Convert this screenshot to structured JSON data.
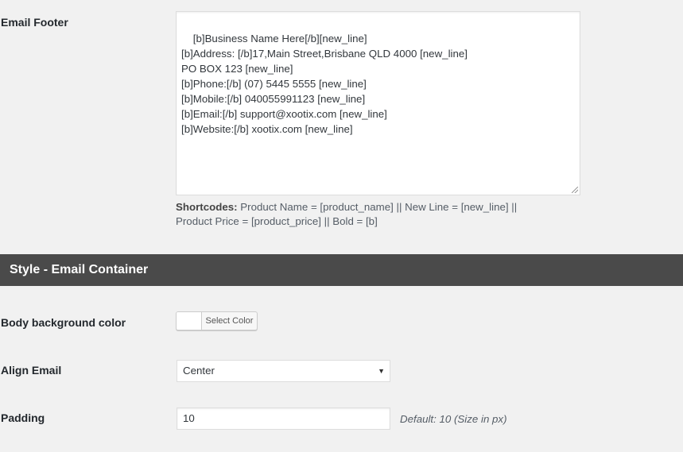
{
  "email_footer": {
    "label": "Email Footer",
    "value": "[b]Business Name Here[/b][new_line]\n[b]Address: [/b]17,Main Street,Brisbane QLD 4000 [new_line]\nPO BOX 123 [new_line]\n[b]Phone:[/b] (07) 5445 5555 [new_line]\n[b]Mobile:[/b] 040055991123 [new_line]\n[b]Email:[/b] support@xootix.com [new_line]\n[b]Website:[/b] xootix.com [new_line]",
    "shortcodes_label": "Shortcodes:",
    "shortcodes_text": " Product Name = [product_name] || New Line = [new_line] || Product Price = [product_price] || Bold = [b]"
  },
  "section": {
    "title": "Style - Email Container"
  },
  "body_background": {
    "label": "Body background color",
    "button_label": "Select Color",
    "color": "#ffffff"
  },
  "align_email": {
    "label": "Align Email",
    "selected": "Center"
  },
  "padding": {
    "label": "Padding",
    "value": "10",
    "hint": "Default: 10 (Size in px)"
  },
  "colors": {
    "background": "#f1f1f1",
    "section_bar": "#4a4a4a"
  }
}
